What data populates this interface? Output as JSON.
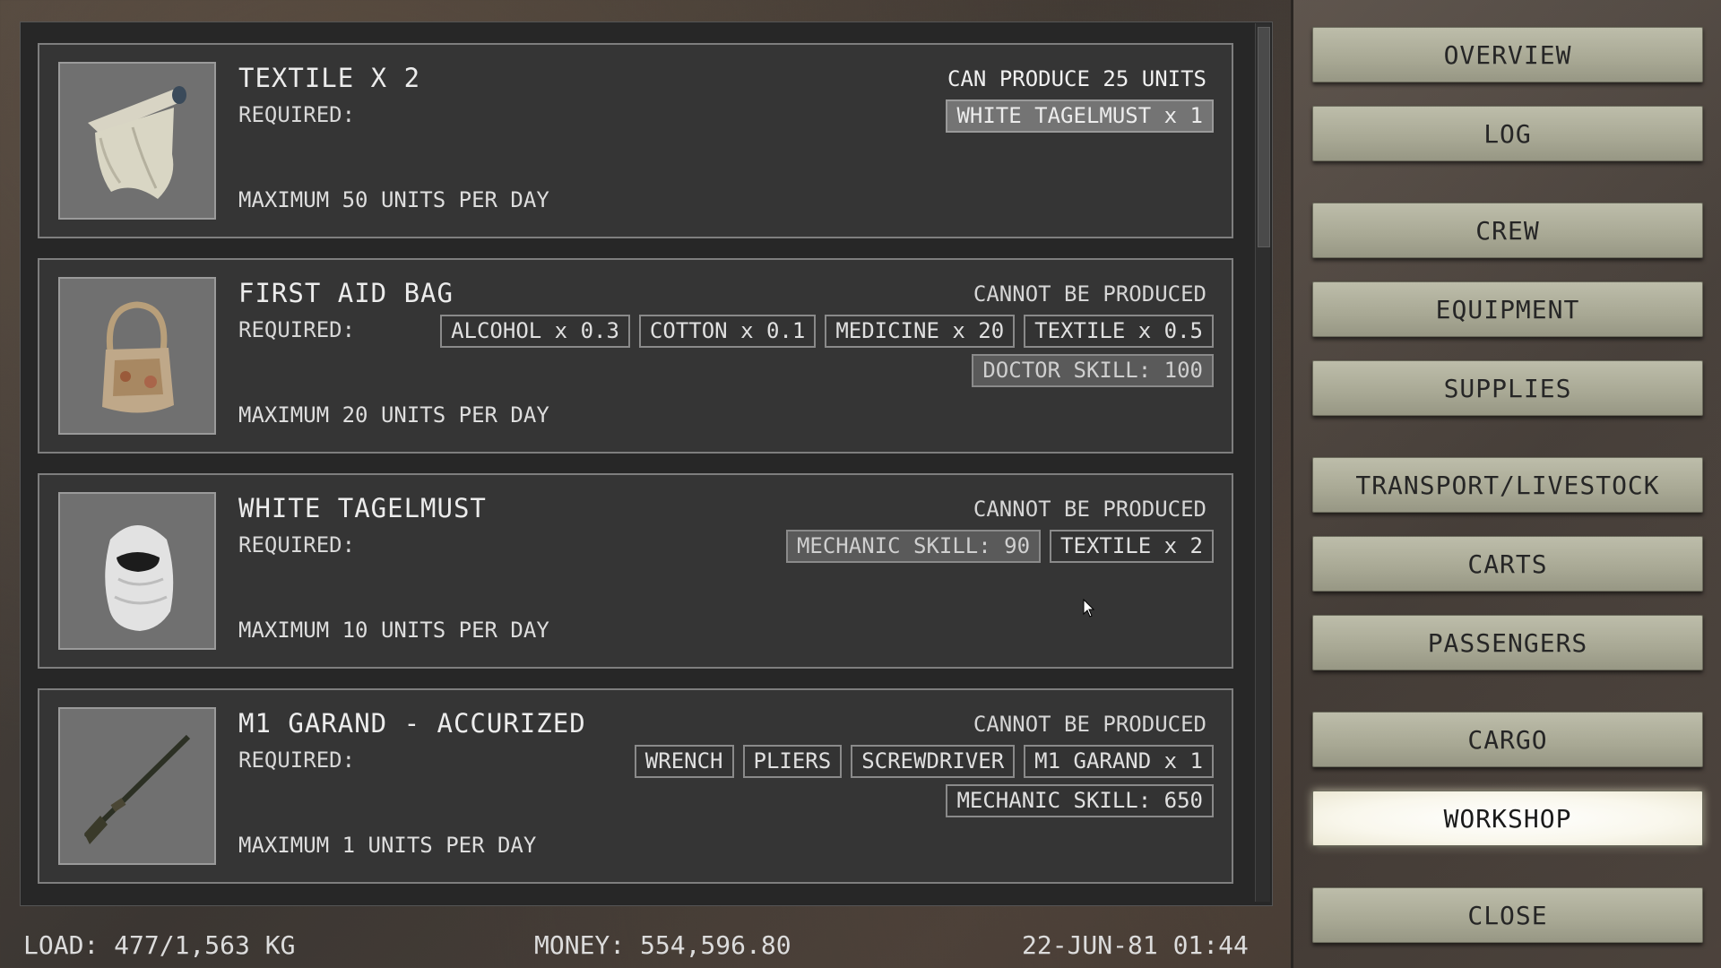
{
  "recipes": [
    {
      "title": "TEXTILE X 2",
      "required_label": "REQUIRED:",
      "status": "CAN PRODUCE 25 UNITS",
      "requirements_row1": [
        "WHITE TAGELMUST x 1"
      ],
      "requirements_row2": [],
      "max_line": "MAXIMUM 50 UNITS PER DAY",
      "icon": "textile-icon"
    },
    {
      "title": "FIRST AID BAG",
      "required_label": "REQUIRED:",
      "status": "CANNOT BE PRODUCED",
      "requirements_row1": [
        "ALCOHOL x 0.3",
        "COTTON x 0.1",
        "MEDICINE x 20",
        "TEXTILE x 0.5"
      ],
      "requirements_row2": [
        "DOCTOR SKILL: 100"
      ],
      "max_line": "MAXIMUM 20 UNITS PER DAY",
      "icon": "first-aid-bag-icon"
    },
    {
      "title": "WHITE TAGELMUST",
      "required_label": "REQUIRED:",
      "status": "CANNOT BE PRODUCED",
      "requirements_row1": [
        "MECHANIC SKILL: 90",
        "TEXTILE x 2"
      ],
      "requirements_row2": [],
      "max_line": "MAXIMUM 10 UNITS PER DAY",
      "icon": "tagelmust-icon"
    },
    {
      "title": "M1 GARAND - ACCURIZED",
      "required_label": "REQUIRED:",
      "status": "CANNOT BE PRODUCED",
      "requirements_row1": [
        "WRENCH",
        "PLIERS",
        "SCREWDRIVER",
        "M1 GARAND x 1"
      ],
      "requirements_row2": [
        "MECHANIC SKILL: 650"
      ],
      "max_line": "MAXIMUM 1 UNITS PER DAY",
      "icon": "rifle-icon"
    }
  ],
  "status_bar": {
    "load": "LOAD: 477/1,563 KG",
    "money": "MONEY: 554,596.80",
    "datetime": "22-JUN-81 01:44"
  },
  "nav": [
    {
      "label": "OVERVIEW",
      "active": false
    },
    {
      "label": "LOG",
      "active": false
    },
    {
      "label": "CREW",
      "active": false
    },
    {
      "label": "EQUIPMENT",
      "active": false
    },
    {
      "label": "SUPPLIES",
      "active": false
    },
    {
      "label": "TRANSPORT/LIVESTOCK",
      "active": false
    },
    {
      "label": "CARTS",
      "active": false
    },
    {
      "label": "PASSENGERS",
      "active": false
    },
    {
      "label": "CARGO",
      "active": false
    },
    {
      "label": "WORKSHOP",
      "active": true
    },
    {
      "label": "CLOSE",
      "active": false
    }
  ],
  "colors": {
    "panel_bg": "#272727",
    "card_bg": "#353535",
    "button_bg": "#a8a894",
    "button_active": "#f9f7ec"
  }
}
